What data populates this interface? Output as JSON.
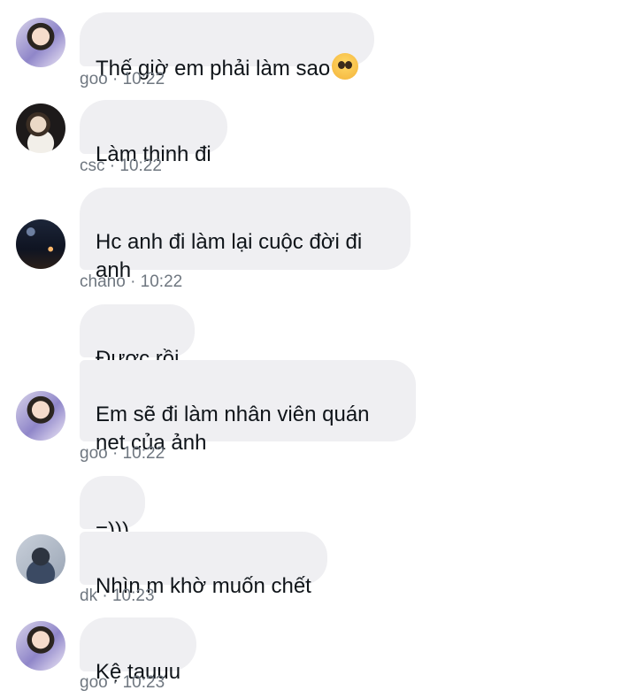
{
  "messages": [
    {
      "sender": "goo",
      "text": "Thế giờ em phải làm sao",
      "emoji": "pleading-face",
      "time": "10:22"
    },
    {
      "sender": "csc",
      "text": "Làm thinh đi",
      "time": "10:22"
    },
    {
      "sender": "chano",
      "text": "Hc anh đi làm lại cuộc đời đi\nanh",
      "time": "10:22"
    },
    {
      "sender": "goo",
      "text": "Được rồi"
    },
    {
      "sender": "goo",
      "text": "Em sẽ đi làm nhân viên quán\nnet của ảnh",
      "time": "10:22"
    },
    {
      "sender": "dk",
      "text": "=)))"
    },
    {
      "sender": "dk",
      "text": "Nhìn m khờ muốn chết",
      "time": "10:23"
    },
    {
      "sender": "goo",
      "text": "Kệ tauuu",
      "time": "10:23"
    }
  ],
  "separator": "·",
  "colors": {
    "bubble": "#efeff2",
    "meta": "#6f7780",
    "text": "#0f1419"
  }
}
